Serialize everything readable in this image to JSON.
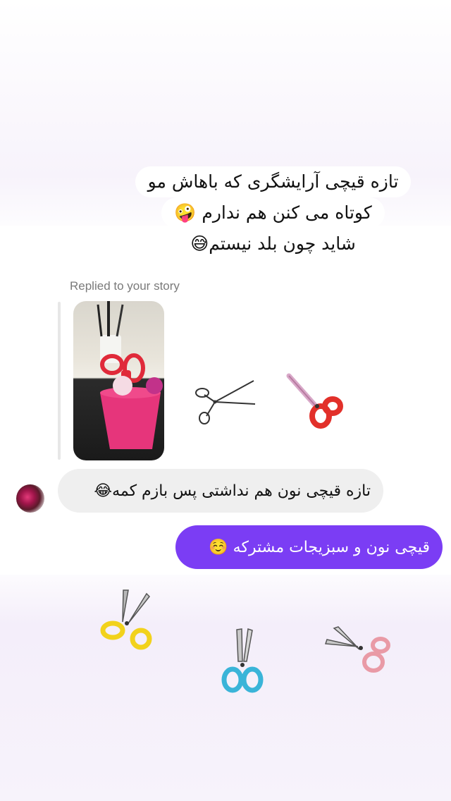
{
  "story_caption": {
    "line1": "تازه قیچی آرایشگری که باهاش مو",
    "line2": "کوتاه می کنن هم ندارم 🤪",
    "line3": "شاید چون بلد نیستم😅"
  },
  "reply_label": "Replied to your story",
  "messages": {
    "incoming": "تازه قیچی نون هم نداشتی پس بازم کمه😂",
    "outgoing": "قیچی نون و سبزیجات مشترکه ☺️"
  },
  "colors": {
    "outgoing_bubble": "#7b3df4",
    "incoming_bubble": "#efefef"
  },
  "stickers": [
    "scissors-sketch-icon",
    "scissors-red-icon",
    "scissors-yellow-icon",
    "scissors-blue-icon",
    "scissors-pink-icon"
  ]
}
